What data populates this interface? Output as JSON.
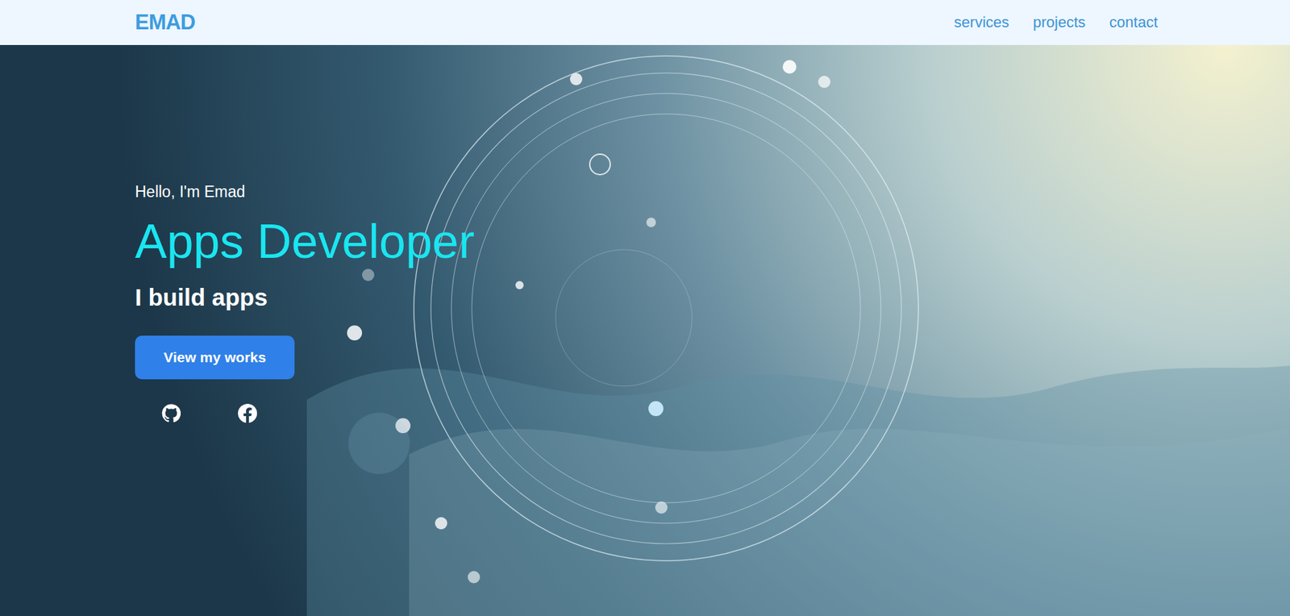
{
  "nav": {
    "logo": "EMAD",
    "links": [
      "services",
      "projects",
      "contact"
    ]
  },
  "hero": {
    "greeting": "Hello, I'm Emad",
    "title": "Apps Developer",
    "subtitle": "I build apps",
    "button": "View my works"
  }
}
